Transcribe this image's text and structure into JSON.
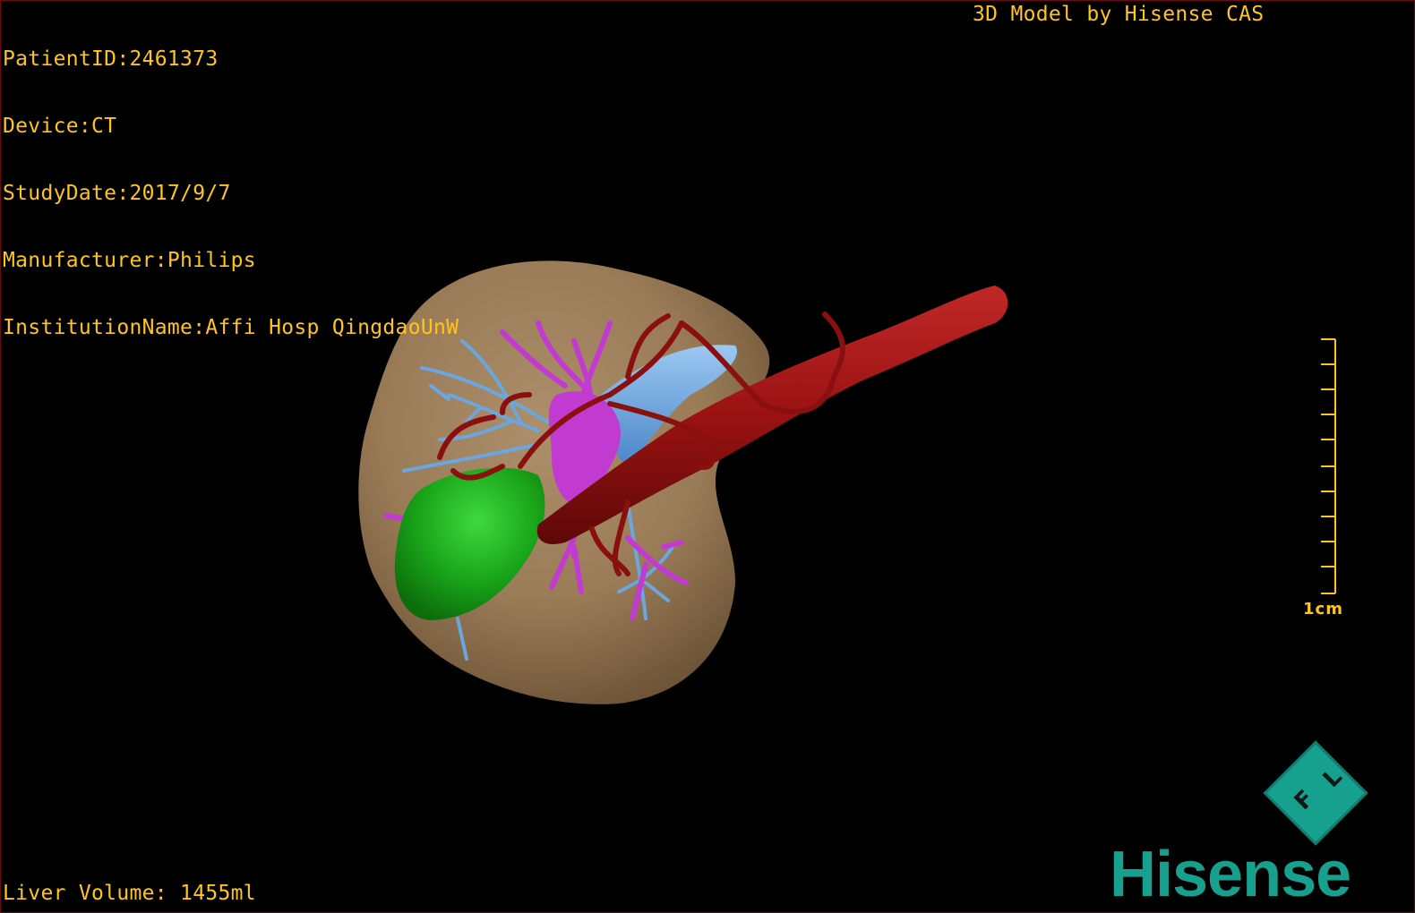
{
  "overlay": {
    "patient_id": "PatientID:2461373",
    "device": "Device:CT",
    "study_date": "StudyDate:2017/9/7",
    "manufacturer": "Manufacturer:Philips",
    "institution": "InstitutionName:Affi Hosp QingdaoUnW",
    "brand_text": "3D Model by Hisense CAS",
    "liver_volume": "Liver Volume: 1455ml"
  },
  "scale_bar": {
    "label": "1cm"
  },
  "orientation": {
    "label_1": "F",
    "label_2": "L"
  },
  "logo": {
    "text": "Hisense"
  },
  "colors": {
    "overlay_text": "#ffc51a",
    "liver": "#9c7d59",
    "gallbladder": "#1fb01f",
    "artery": "#a01818",
    "portal_vein": "#c23bd1",
    "hepatic_vein": "#6aa6e0",
    "logo": "#18a08e"
  },
  "icons": {
    "orientation_cube": "orientation-cube-icon",
    "scale_bar": "ruler-icon"
  }
}
